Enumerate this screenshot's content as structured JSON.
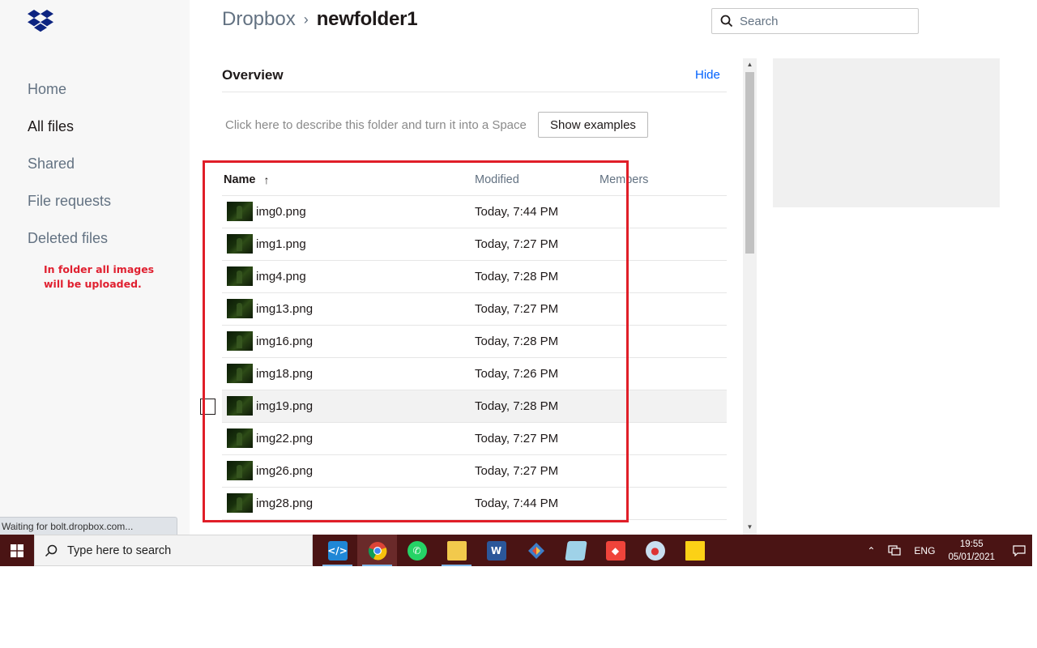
{
  "sidebar": {
    "items": [
      {
        "label": "Home",
        "active": false
      },
      {
        "label": "All files",
        "active": true
      },
      {
        "label": "Shared",
        "active": false
      },
      {
        "label": "File requests",
        "active": false
      },
      {
        "label": "Deleted files",
        "active": false
      }
    ],
    "annotation": "In folder all images will be uploaded."
  },
  "header": {
    "breadcrumb_root": "Dropbox",
    "breadcrumb_separator": "›",
    "breadcrumb_current": "newfolder1",
    "search_placeholder": "Search"
  },
  "overview": {
    "title": "Overview",
    "hide_label": "Hide",
    "description_prompt": "Click here to describe this folder and turn it into a Space",
    "show_examples_label": "Show examples"
  },
  "table": {
    "columns": {
      "name": "Name",
      "modified": "Modified",
      "members": "Members"
    },
    "sort_indicator": "↑",
    "rows": [
      {
        "name": "img0.png",
        "modified": "Today, 7:44 PM"
      },
      {
        "name": "img1.png",
        "modified": "Today, 7:27 PM"
      },
      {
        "name": "img4.png",
        "modified": "Today, 7:28 PM"
      },
      {
        "name": "img13.png",
        "modified": "Today, 7:27 PM"
      },
      {
        "name": "img16.png",
        "modified": "Today, 7:28 PM"
      },
      {
        "name": "img18.png",
        "modified": "Today, 7:26 PM"
      },
      {
        "name": "img19.png",
        "modified": "Today, 7:28 PM"
      },
      {
        "name": "img22.png",
        "modified": "Today, 7:27 PM"
      },
      {
        "name": "img26.png",
        "modified": "Today, 7:27 PM"
      },
      {
        "name": "img28.png",
        "modified": "Today, 7:44 PM"
      }
    ],
    "partial_row_modified": "Today, 7:27 PM",
    "hovered_row_index": 6
  },
  "status_bar": {
    "text": "Waiting for bolt.dropbox.com..."
  },
  "taskbar": {
    "search_placeholder": "Type here to search",
    "apps": [
      "vscode-icon",
      "chrome-icon",
      "whatsapp-icon",
      "file-explorer-icon",
      "word-icon",
      "git-icon",
      "notepad-icon",
      "anydesk-icon",
      "paint-icon",
      "sticky-notes-icon"
    ],
    "tray": {
      "language": "ENG",
      "time": "19:55",
      "date": "05/01/2021"
    }
  },
  "colors": {
    "accent_link": "#0061fe",
    "annotation_red": "#e02030",
    "highlight_box": "#e01e28",
    "taskbar": "#4a1414"
  }
}
